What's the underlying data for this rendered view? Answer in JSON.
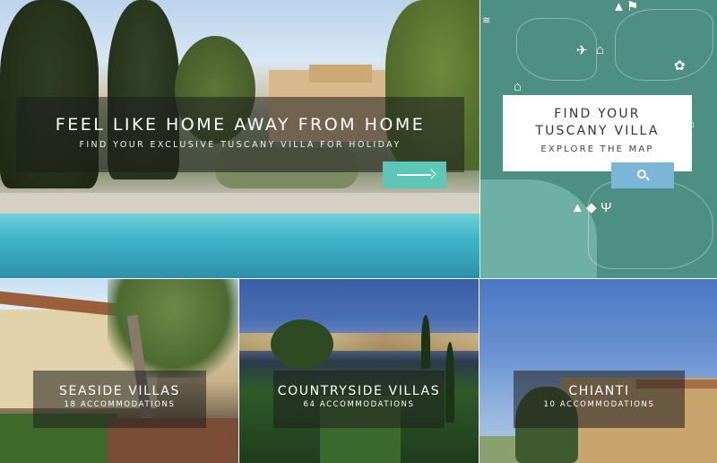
{
  "hero": {
    "title": "FEEL LIKE HOME AWAY FROM HOME",
    "subtitle": "FIND YOUR EXCLUSIVE TUSCANY VILLA FOR HOLIDAY",
    "arrow_icon": "arrow-right-icon",
    "accent_color": "#5ec6b6"
  },
  "map_panel": {
    "title_line1": "FIND YOUR",
    "title_line2": "TUSCANY VILLA",
    "cta": "EXPLORE THE MAP",
    "search_icon": "search-icon",
    "button_color": "#7bb5d8",
    "map_color": "#4e8f84",
    "icons": [
      "waves-icon",
      "tree-icon",
      "hiker-icon",
      "airplane-icon",
      "museum-icon",
      "grapes-icon",
      "museum-icon",
      "tree-icon",
      "cheese-icon",
      "dining-icon",
      "museum-icon"
    ]
  },
  "tiles": [
    {
      "title": "SEASIDE VILLAS",
      "count": "18 ACCOMMODATIONS"
    },
    {
      "title": "COUNTRYSIDE VILLAS",
      "count": "64 ACCOMMODATIONS"
    },
    {
      "title": "CHIANTI",
      "count": "10 ACCOMMODATIONS"
    }
  ]
}
